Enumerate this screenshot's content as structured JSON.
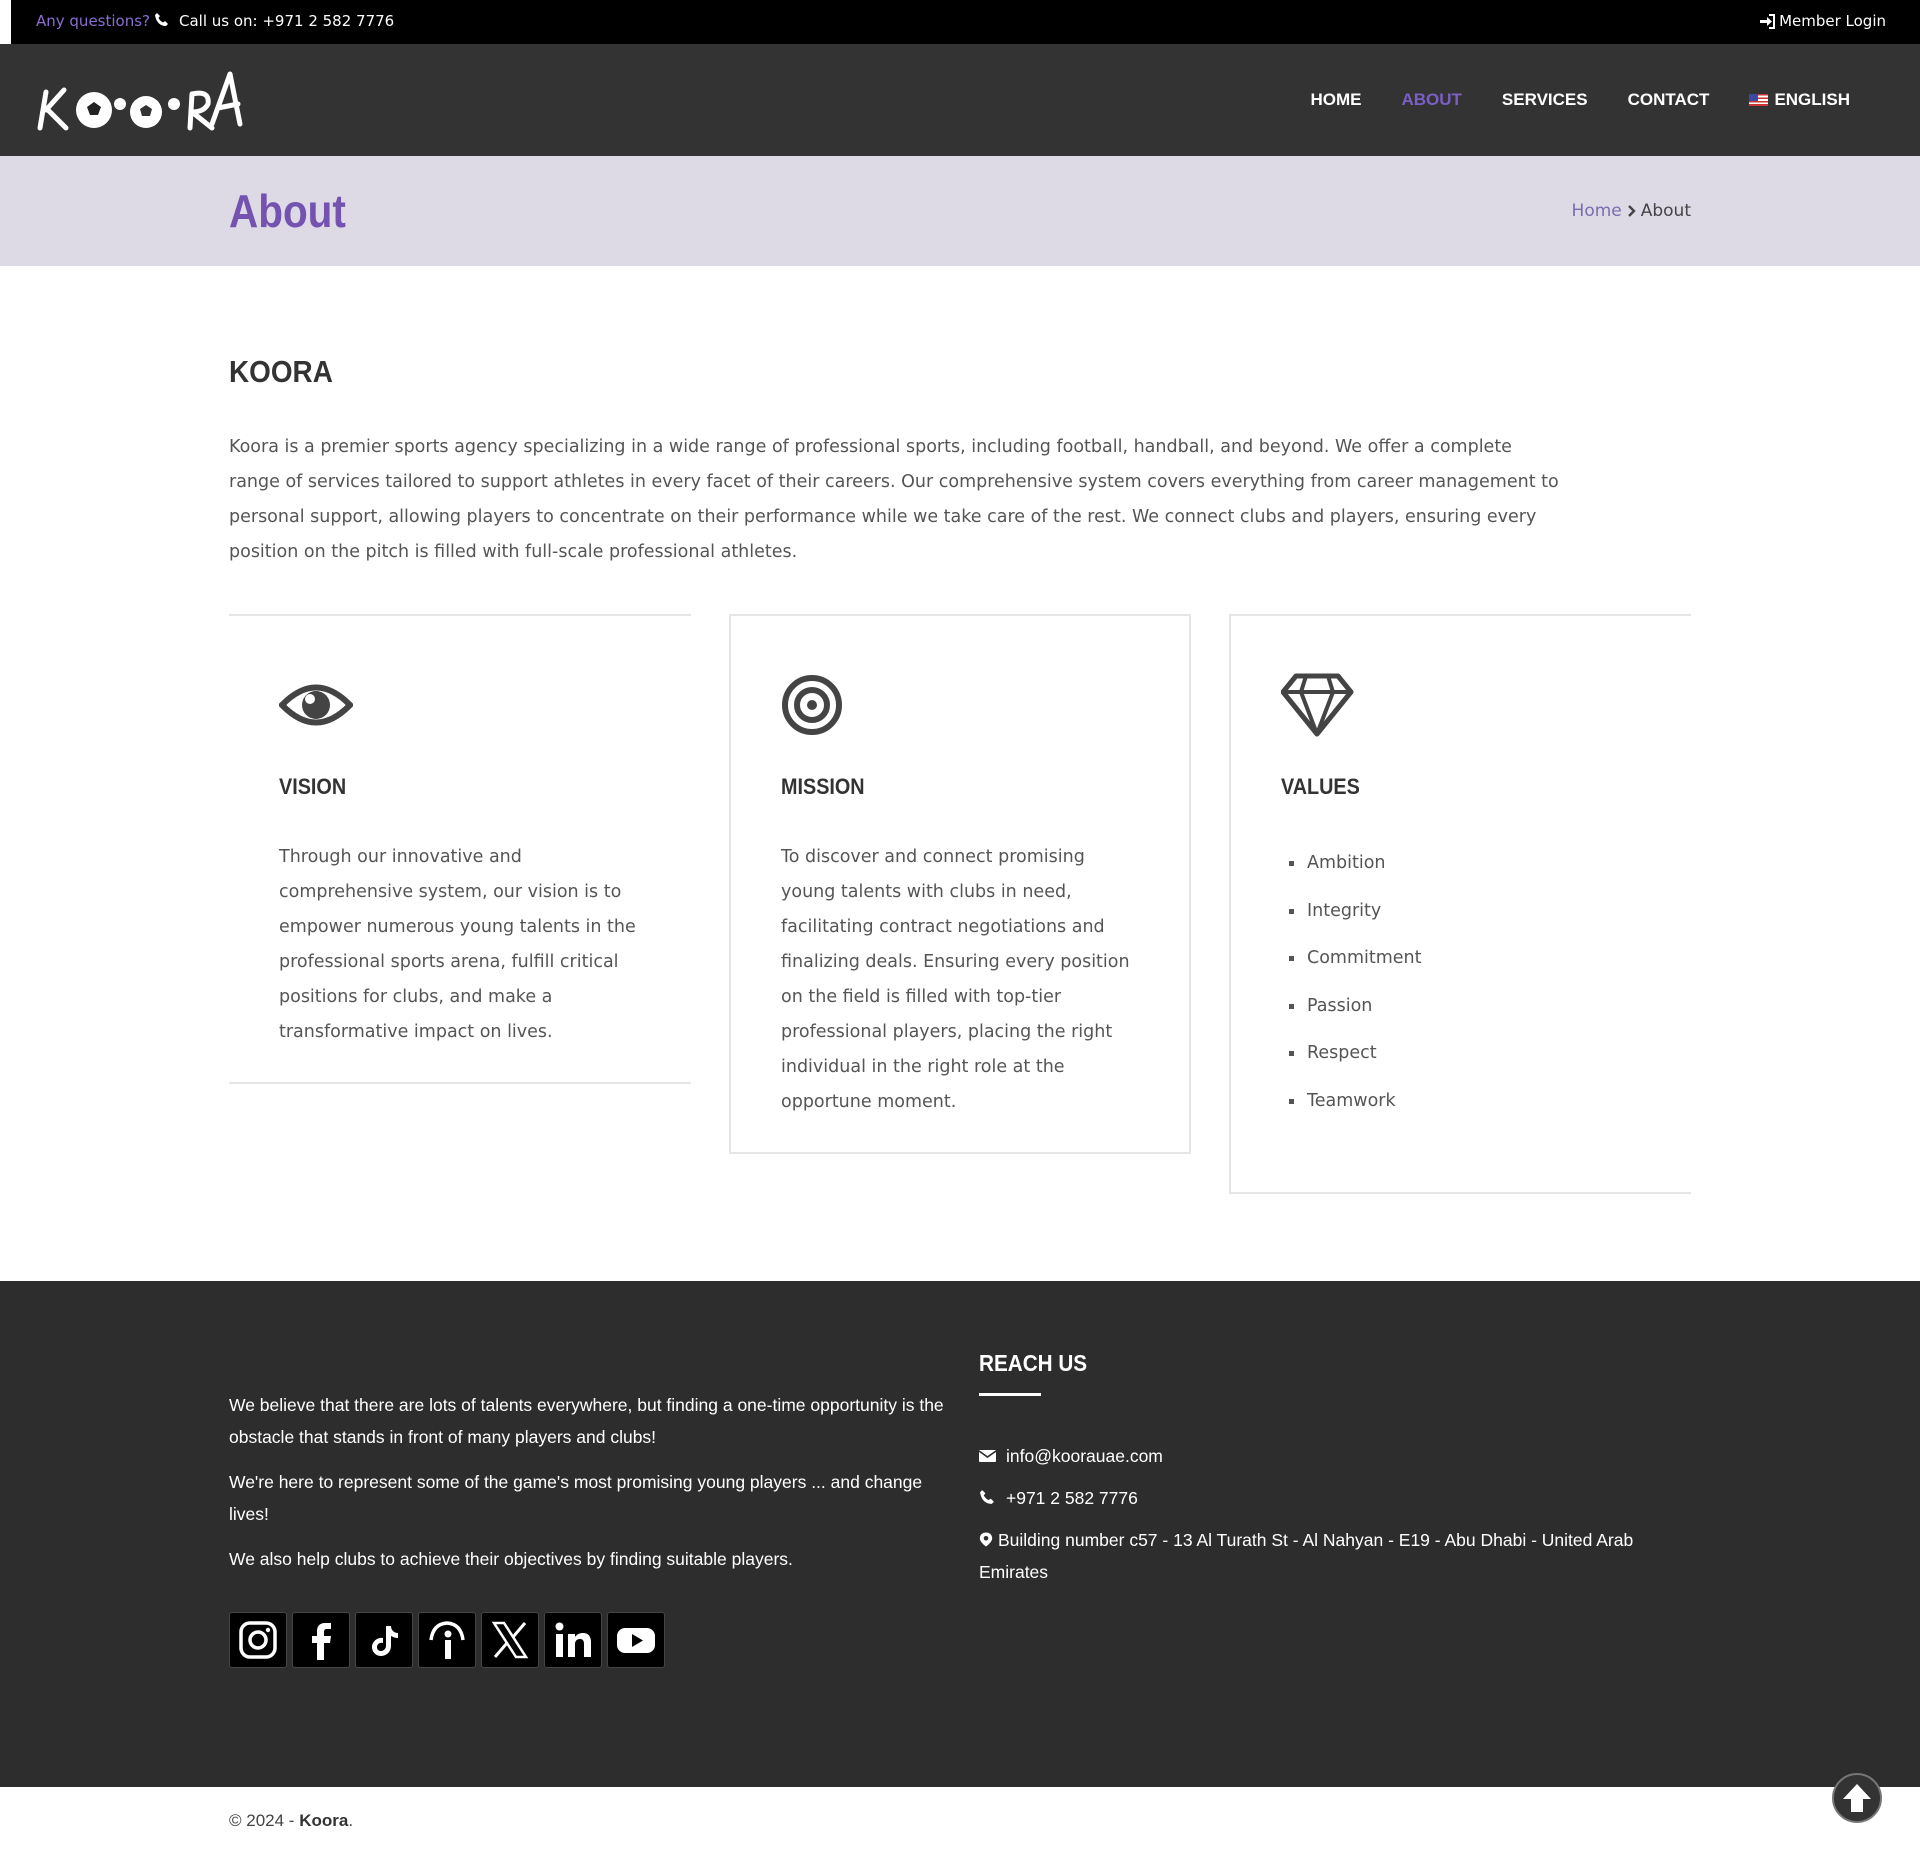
{
  "topbar": {
    "questions": "Any questions?",
    "call": "Call us on: +971 2 582 7776",
    "member_login": "Member Login"
  },
  "header": {
    "logo_text": "KOORA",
    "nav": [
      {
        "label": "HOME",
        "active": false
      },
      {
        "label": "ABOUT",
        "active": true
      },
      {
        "label": "SERVICES",
        "active": false
      },
      {
        "label": "CONTACT",
        "active": false
      },
      {
        "label": "ENGLISH",
        "active": false
      }
    ]
  },
  "titlebar": {
    "title": "About",
    "breadcrumb_home": "Home",
    "breadcrumb_current": "About"
  },
  "main": {
    "heading": "KOORA",
    "intro": "Koora is a premier sports agency specializing in a wide range of professional sports, including football, handball, and beyond. We offer a complete range of services tailored to support athletes in every facet of their careers. Our comprehensive system covers everything from career management to personal support, allowing players to concentrate on their performance while we take care of the rest. We connect clubs and players, ensuring every position on the pitch is filled with full-scale professional athletes.",
    "vision": {
      "title": "VISION",
      "text": "Through our innovative and comprehensive system, our vision is to empower numerous young talents in the professional sports arena, fulfill critical positions for clubs, and make a transformative impact on lives."
    },
    "mission": {
      "title": "MISSION",
      "text": "To discover and connect promising young talents with clubs in need, facilitating contract negotiations and finalizing deals. Ensuring every position on the field is filled with top-tier professional players, placing the right individual in the right role at the opportune moment."
    },
    "values": {
      "title": "VALUES",
      "items": [
        "Ambition",
        "Integrity",
        "Commitment",
        "Passion",
        "Respect",
        "Teamwork"
      ]
    }
  },
  "footer": {
    "p1": "We believe that there are lots of talents everywhere, but finding a one-time opportunity is the obstacle that stands in front of many players and clubs!",
    "p2": "We're here to represent some of the game's most promising young players ... and change lives!",
    "p3": "We also help clubs to achieve their objectives by finding suitable players.",
    "social": [
      "instagram-icon",
      "facebook-icon",
      "tiktok-icon",
      "info-icon",
      "x-icon",
      "linkedin-icon",
      "youtube-icon"
    ],
    "reach_title": "REACH US",
    "email": "info@koorauae.com",
    "phone": "+971 2 582 7776",
    "address": "Building number c57 - 13 Al Turath St - Al Nahyan - E19 - Abu Dhabi - United Arab Emirates"
  },
  "bottom": {
    "copy_prefix": "© 2024 - ",
    "copy_brand": "Koora",
    "copy_suffix": "."
  },
  "colors": {
    "accent": "#7352b0",
    "topbar": "#000000",
    "header": "#333333",
    "titlebar": "#dddae6",
    "footer": "#2d2d2d"
  }
}
